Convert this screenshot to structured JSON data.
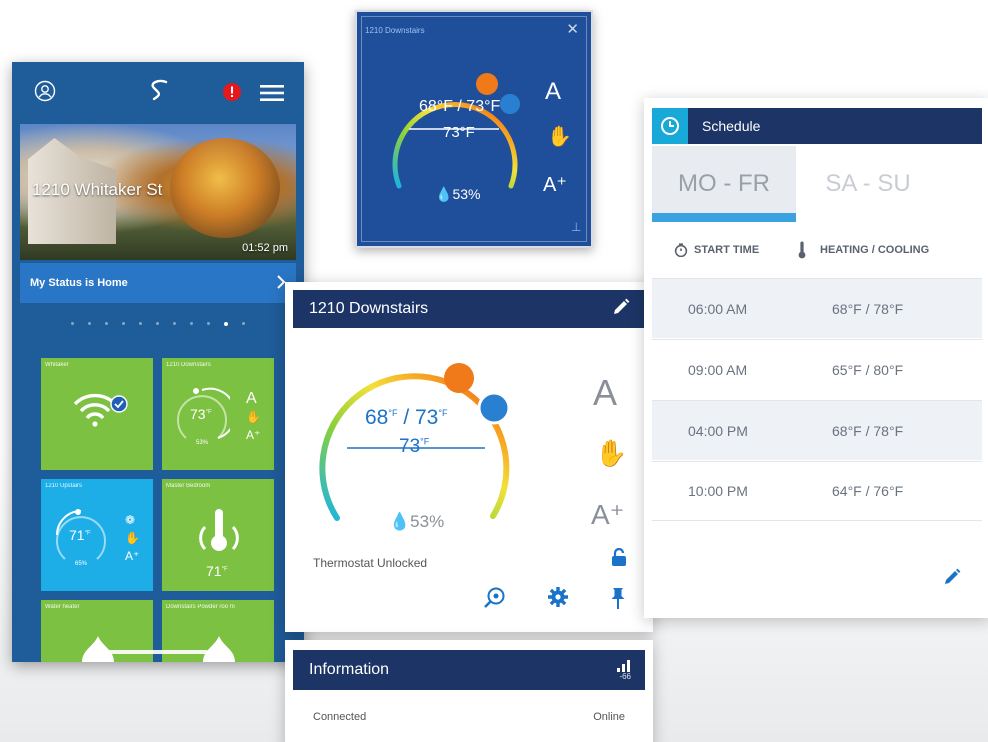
{
  "phone": {
    "hero": {
      "address": "1210 Whitaker St",
      "time": "01:52 pm"
    },
    "status": {
      "text": "My Status is Home"
    },
    "tiles": [
      {
        "name": "Whitaker"
      },
      {
        "name": "1210 Downstairs",
        "temp": "73",
        "unit": "°F",
        "humidity": "53%"
      },
      {
        "name": "1210 Upstairs",
        "temp": "71",
        "unit": "°F",
        "humidity": "65%"
      },
      {
        "name": "Master Bedroom",
        "temp": "71",
        "unit": "°F"
      },
      {
        "name": "Water heater"
      },
      {
        "name": "Downstairs Powder roo m"
      }
    ]
  },
  "mini": {
    "title": "1210 Downstairs",
    "setpoints": "68°F / 73°F",
    "current": "73°F",
    "humidity": "53%"
  },
  "thermostat": {
    "title": "1210 Downstairs",
    "heat": "68",
    "cool": "73",
    "unit": "°F",
    "separator": "/",
    "current": "73",
    "humidity": "53%",
    "lock_label": "Thermostat Unlocked"
  },
  "info": {
    "title": "Information",
    "signal": "-66",
    "row_label": "Connected",
    "row_value": "Online"
  },
  "schedule": {
    "title": "Schedule",
    "tabs": [
      "MO - FR",
      "SA - SU"
    ],
    "col_time": "START TIME",
    "col_temp": "HEATING / COOLING",
    "rows": [
      {
        "time": "06:00 AM",
        "temps": "68°F / 78°F"
      },
      {
        "time": "09:00 AM",
        "temps": "65°F / 80°F"
      },
      {
        "time": "04:00 PM",
        "temps": "68°F / 78°F"
      },
      {
        "time": "10:00 PM",
        "temps": "64°F / 76°F"
      }
    ]
  },
  "colors": {
    "phone_bg": "#1f5c9a",
    "header_navy": "#1c3566",
    "tile_green": "#7cc142",
    "tile_blue": "#1daee8",
    "accent_blue": "#1a73c9",
    "heat_orange": "#f07a1a",
    "cool_blue": "#2a80d0",
    "alert_red": "#e5191b"
  }
}
